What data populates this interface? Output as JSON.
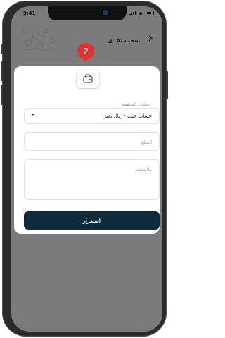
{
  "status_bar": {
    "time": "9:41"
  },
  "header": {
    "title": "سحب نقدي",
    "back_icon": "chevron-right-icon"
  },
  "step": {
    "number": "2",
    "color": "#e63030"
  },
  "form": {
    "wallet_account_label": "حساب المحفظة",
    "wallet_account_value": "حساب جيب - ريال يمني",
    "amount_placeholder": "المبلغ",
    "notes_placeholder": "ملاحظات",
    "continue_label": "استمرار"
  },
  "colors": {
    "primary": "#0e2a3d",
    "overlay": "#7b7b7b"
  }
}
